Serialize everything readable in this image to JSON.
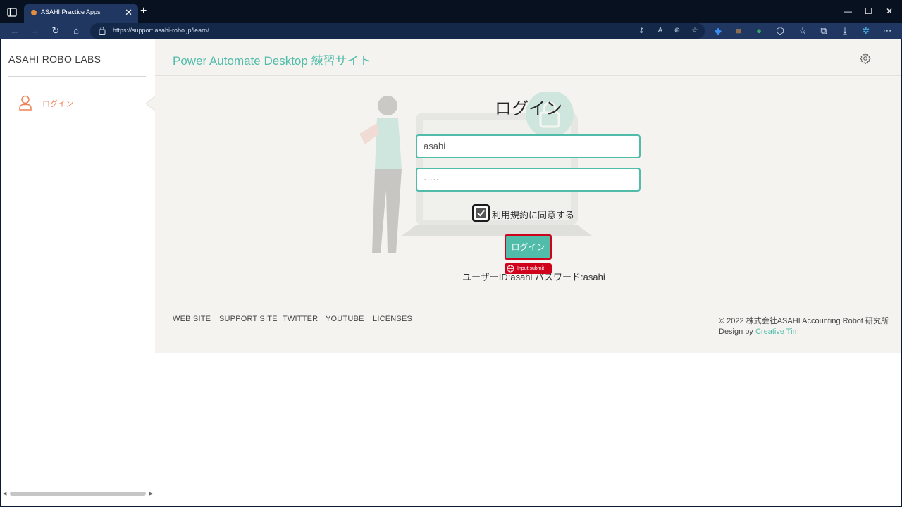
{
  "browser": {
    "tab_title": "ASAHI Practice Apps",
    "tab_close": "✕",
    "new_tab": "+",
    "url": "https://support.asahi-robo.jp/learn/",
    "window_controls": [
      "—",
      "☐",
      "✕"
    ]
  },
  "sidebar": {
    "brand": "ASAHI ROBO LABS",
    "items": [
      {
        "label": "ログイン",
        "icon": "user-icon"
      }
    ]
  },
  "header": {
    "title": "Power Automate Desktop 練習サイト"
  },
  "login": {
    "heading": "ログイン",
    "username_value": "asahi",
    "password_value": "·····",
    "agree_label": "利用規約に同意する",
    "agree_checked": true,
    "submit_label": "ログイン",
    "automation_tag": "Input submit",
    "hint": "ユーザーID:asahi パスワード:asahi"
  },
  "footer": {
    "links": [
      "WEB SITE",
      "SUPPORT SITE",
      "TWITTER",
      "YOUTUBE",
      "LICENSES"
    ],
    "copyright": "© 2022 株式会社ASAHI Accounting Robot 研究所",
    "design_prefix": "Design by",
    "design_link": "Creative Tim"
  },
  "colors": {
    "accent": "#51bcaa",
    "nav_active": "#ef8157",
    "browser_bg": "#1f3761",
    "highlight": "#d0021b"
  }
}
